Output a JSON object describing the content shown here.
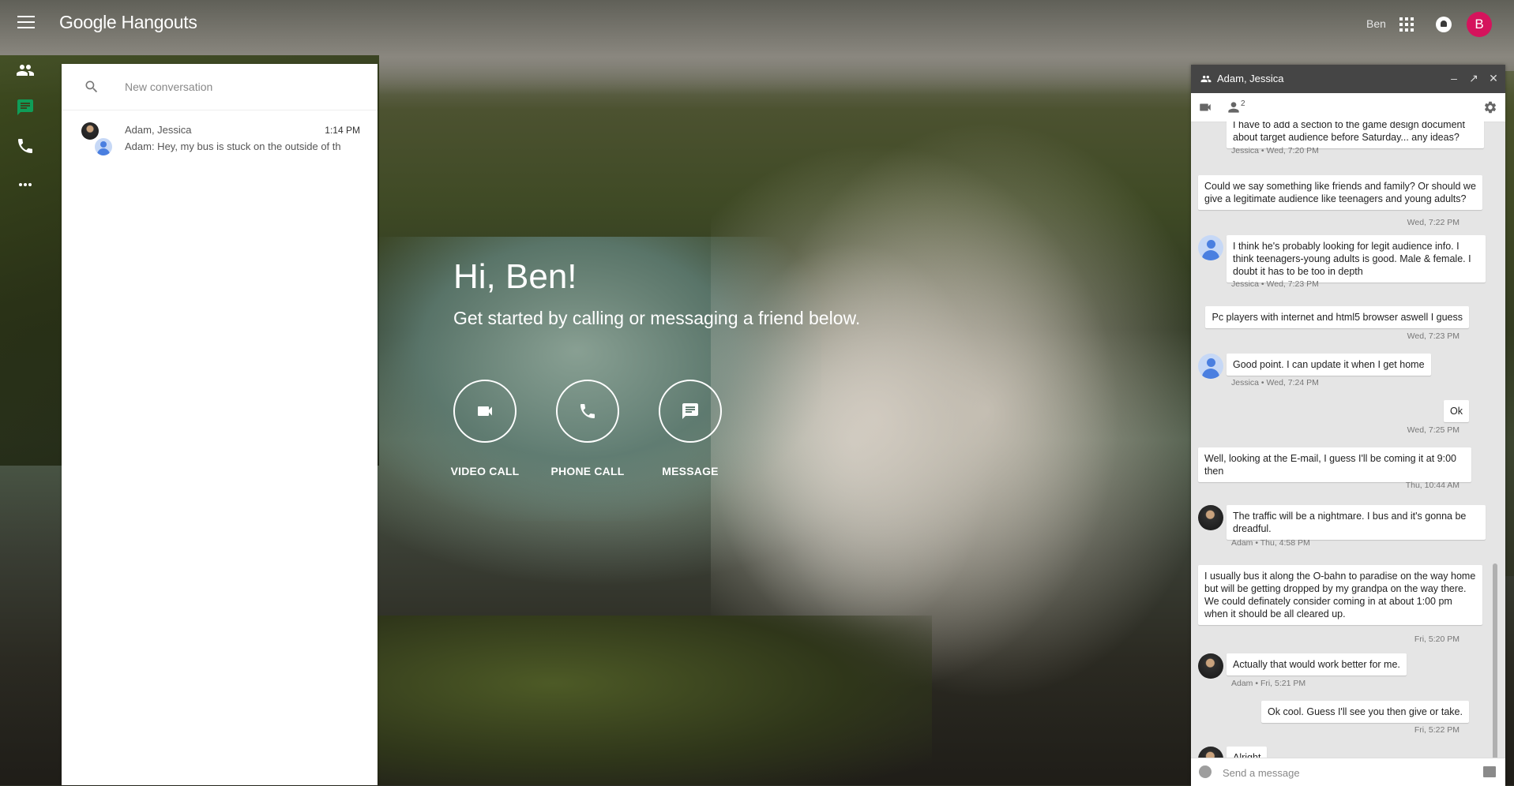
{
  "app": {
    "brand": "Google Hangouts"
  },
  "header": {
    "user_name": "Ben",
    "avatar_letter": "B",
    "avatar_color": "#d5135c"
  },
  "rail": {
    "active_color": "#0f9d58"
  },
  "search": {
    "placeholder": "New conversation"
  },
  "conversations": [
    {
      "name": "Adam, Jessica",
      "time": "1:14 PM",
      "preview": "Adam: Hey, my bus is stuck on the outside of th"
    }
  ],
  "greeting": {
    "title": "Hi, Ben!",
    "subtitle": "Get started by calling or messaging a friend below."
  },
  "actions": [
    {
      "label": "VIDEO CALL",
      "icon": "videocam-icon"
    },
    {
      "label": "PHONE CALL",
      "icon": "phone-icon"
    },
    {
      "label": "MESSAGE",
      "icon": "message-icon"
    }
  ],
  "chat": {
    "title": "Adam, Jessica",
    "participant_count": "2",
    "input_placeholder": "Send a message",
    "messages": [
      {
        "text": "I have to add a section to the game design document about target audience before Saturday... any ideas?",
        "meta": "Jessica • Wed, 7:20 PM"
      },
      {
        "text": "Could we say something like friends and family? Or should we give a legitimate audience like teenagers and young adults?",
        "meta": "Wed, 7:22 PM"
      },
      {
        "text": "I think he's probably looking for legit audience info. I think teenagers-young adults is good. Male & female. I doubt it has to be too in depth",
        "meta": "Jessica • Wed, 7:23 PM"
      },
      {
        "text": "Pc players with internet and html5 browser aswell I guess",
        "meta": "Wed, 7:23 PM"
      },
      {
        "text": "Good point. I can update it when I get home",
        "meta": "Jessica • Wed, 7:24 PM"
      },
      {
        "text": "Ok",
        "meta": "Wed, 7:25 PM"
      },
      {
        "text": "Well, looking at the E-mail, I guess I'll be coming it at 9:00 then",
        "meta": "Thu, 10:44 AM"
      },
      {
        "text": "The traffic will be a nightmare. I bus and it's gonna be dreadful.",
        "meta": "Adam • Thu, 4:58 PM"
      },
      {
        "text": "I usually bus it along the O-bahn to paradise on the way home but will be getting dropped by my grandpa on the way there. We could definately consider coming in at about 1:00 pm when it should be all cleared up.",
        "meta": "Fri, 5:20 PM"
      },
      {
        "text": "Actually that would work better for me.",
        "meta": "Adam • Fri, 5:21 PM"
      },
      {
        "text": "Ok cool. Guess I'll see you then give or take.",
        "meta": "Fri, 5:22 PM"
      },
      {
        "text": "Alright",
        "meta": ""
      }
    ]
  }
}
